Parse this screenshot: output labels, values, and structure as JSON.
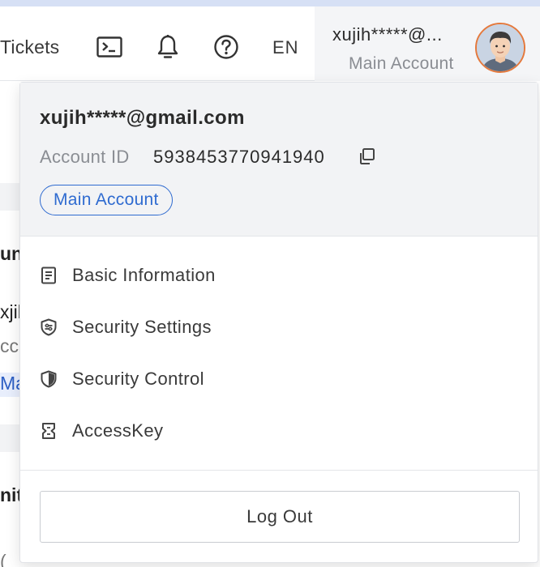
{
  "header": {
    "tickets_label": "Tickets",
    "terminal_icon": "terminal-icon",
    "bell_icon": "bell-icon",
    "help_icon": "help-icon",
    "language": "EN",
    "account": {
      "email_short": "xujih*****@...",
      "type": "Main Account",
      "avatar": "avatar-icon"
    }
  },
  "background_page": {
    "t1": "un",
    "t2": "xjih",
    "t3": "cc",
    "t4": "Ma",
    "t5": "nit",
    "t6": "("
  },
  "dropdown": {
    "email": "xujih*****@gmail.com",
    "account_id_label": "Account ID",
    "account_id_value": "5938453770941940",
    "badge": "Main Account",
    "menu": [
      {
        "label": "Basic Information",
        "icon": "document-icon"
      },
      {
        "label": "Security Settings",
        "icon": "shield-settings-icon"
      },
      {
        "label": "Security Control",
        "icon": "shield-icon"
      },
      {
        "label": "AccessKey",
        "icon": "key-icon"
      }
    ],
    "logout_label": "Log Out"
  },
  "colors": {
    "accent": "#2f6bd0",
    "avatar_border": "#e5793c",
    "panel_header_bg": "#f2f3f5"
  }
}
